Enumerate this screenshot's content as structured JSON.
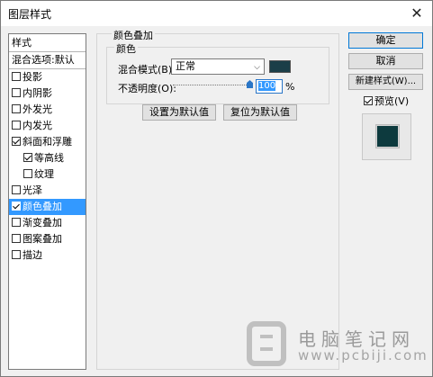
{
  "window": {
    "title": "图层样式",
    "close": "✕"
  },
  "styles_list": {
    "header": "样式",
    "blend": "混合选项:默认",
    "items": [
      {
        "label": "投影",
        "checked": false
      },
      {
        "label": "内阴影",
        "checked": false
      },
      {
        "label": "外发光",
        "checked": false
      },
      {
        "label": "内发光",
        "checked": false
      },
      {
        "label": "斜面和浮雕",
        "checked": true
      },
      {
        "label": "等高线",
        "checked": true
      },
      {
        "label": "纹理",
        "checked": false
      },
      {
        "label": "光泽",
        "checked": false
      },
      {
        "label": "颜色叠加",
        "checked": true,
        "selected": true
      },
      {
        "label": "渐变叠加",
        "checked": false
      },
      {
        "label": "图案叠加",
        "checked": false
      },
      {
        "label": "描边",
        "checked": false
      }
    ]
  },
  "color_overlay": {
    "group_title": "颜色叠加",
    "sub_title": "颜色",
    "blend_mode_label": "混合模式(B):",
    "blend_mode_value": "正常",
    "opacity_label": "不透明度(O):",
    "opacity_value": "100",
    "opacity_unit": "%",
    "overlay_color": "#1b3e48",
    "set_default": "设置为默认值",
    "reset_default": "复位为默认值"
  },
  "buttons": {
    "ok": "确定",
    "cancel": "取消",
    "new_style": "新建样式(W)...",
    "preview": "预览(V)"
  },
  "watermark": {
    "line1": "电脑笔记网",
    "line2": "www.pcbiji.com"
  }
}
